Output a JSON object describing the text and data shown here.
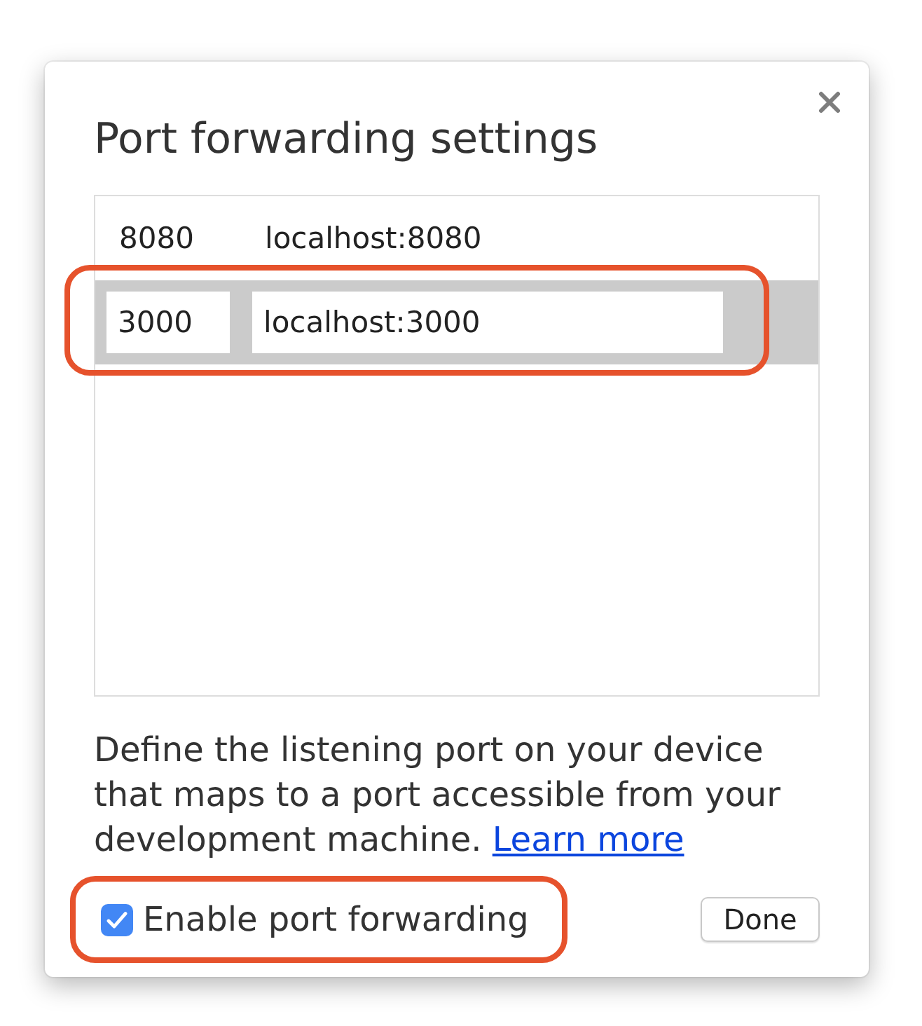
{
  "dialog": {
    "title": "Port forwarding settings"
  },
  "rules": [
    {
      "port": "8080",
      "address": "localhost:8080",
      "selected": false,
      "highlighted": false
    },
    {
      "port": "3000",
      "address": "localhost:3000",
      "selected": true,
      "highlighted": true
    }
  ],
  "description": {
    "text": "Define the listening port on your device that maps to a port accessible from your development machine.",
    "link": "Learn more"
  },
  "enable_checkbox": {
    "label": "Enable port forwarding",
    "checked": true,
    "highlighted": true
  },
  "done_button": {
    "label": "Done"
  }
}
